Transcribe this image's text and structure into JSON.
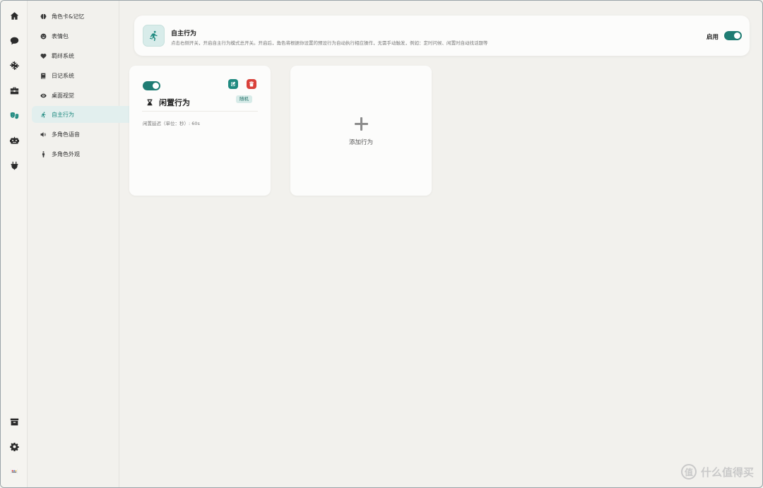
{
  "rail": {
    "items": [
      {
        "icon": "home-icon"
      },
      {
        "icon": "chat-icon"
      },
      {
        "icon": "snowflake-icon"
      },
      {
        "icon": "toolbox-icon"
      },
      {
        "icon": "theater-masks-icon",
        "active": true
      },
      {
        "icon": "robot-icon"
      },
      {
        "icon": "plug-icon"
      }
    ],
    "bottom": [
      {
        "icon": "archive-icon"
      },
      {
        "icon": "gear-icon"
      },
      {
        "icon": "language-flag-icon"
      }
    ]
  },
  "subnav": {
    "items": [
      {
        "label": "角色卡&记忆",
        "icon": "brain-icon"
      },
      {
        "label": "表情包",
        "icon": "smile-icon"
      },
      {
        "label": "羁绊系统",
        "icon": "heart-icon"
      },
      {
        "label": "日记系统",
        "icon": "book-icon"
      },
      {
        "label": "桌面视觉",
        "icon": "eye-icon"
      },
      {
        "label": "自主行为",
        "icon": "running-icon",
        "active": true
      },
      {
        "label": "多角色语音",
        "icon": "speaker-icon"
      },
      {
        "label": "多角色外观",
        "icon": "person-icon"
      }
    ]
  },
  "header": {
    "title": "自主行为",
    "description": "点击右侧开关，开启自主行为模式总开关。开启后，角色将根据你设置的预设行为自动执行相应操作，无需手动触发，例如：定时问候、闲置时自动找话题等",
    "toggle_label": "启用",
    "enabled": true
  },
  "behaviors": [
    {
      "enabled": true,
      "name": "闲置行为",
      "icon": "hourglass-icon",
      "badge": "随机",
      "meta": "闲置延迟（单位：秒）: 60s"
    }
  ],
  "add_card": {
    "label": "添加行为"
  },
  "watermark": {
    "text": "什么值得买",
    "logo_char": "值"
  },
  "colors": {
    "accent": "#1f8a80",
    "toggle_on": "#1f7c73",
    "edit_button": "#1f8a80",
    "delete_button": "#d9413b",
    "background": "#f2f1ed",
    "card": "#fcfcfb"
  }
}
